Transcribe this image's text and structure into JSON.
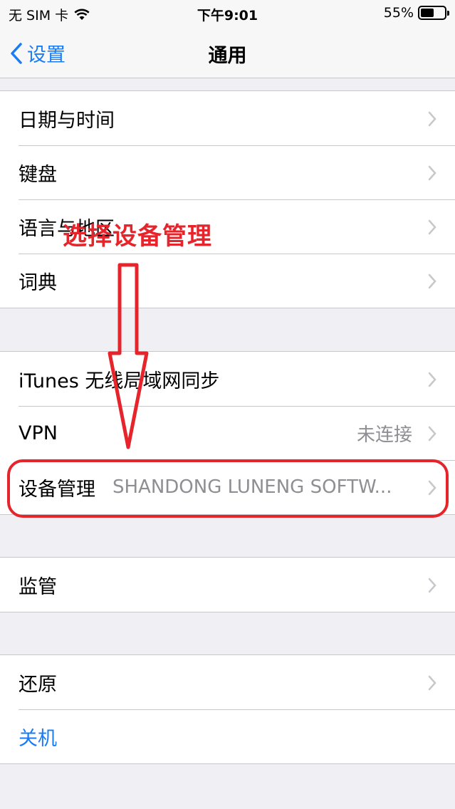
{
  "status_bar": {
    "carrier": "无 SIM 卡",
    "time": "下午9:01",
    "battery_text": "55%",
    "battery_level": 0.55
  },
  "nav": {
    "back_label": "设置",
    "title": "通用"
  },
  "groups": [
    {
      "rows": [
        {
          "label": "日期与时间"
        },
        {
          "label": "键盘"
        },
        {
          "label": "语言与地区"
        },
        {
          "label": "词典"
        }
      ]
    },
    {
      "rows": [
        {
          "label": "iTunes 无线局域网同步"
        },
        {
          "label": "VPN",
          "value": "未连接"
        },
        {
          "label": "设备管理",
          "value": "SHANDONG LUNENG SOFTW..."
        }
      ]
    },
    {
      "rows": [
        {
          "label": "监管"
        }
      ]
    },
    {
      "rows": [
        {
          "label": "还原"
        },
        {
          "label": "关机"
        }
      ]
    }
  ],
  "annotation": {
    "text": "选择设备管理",
    "color": "#e5242b"
  },
  "colors": {
    "accent": "#1a7cf5",
    "background": "#efeff4",
    "separator": "#c8c7cc"
  }
}
